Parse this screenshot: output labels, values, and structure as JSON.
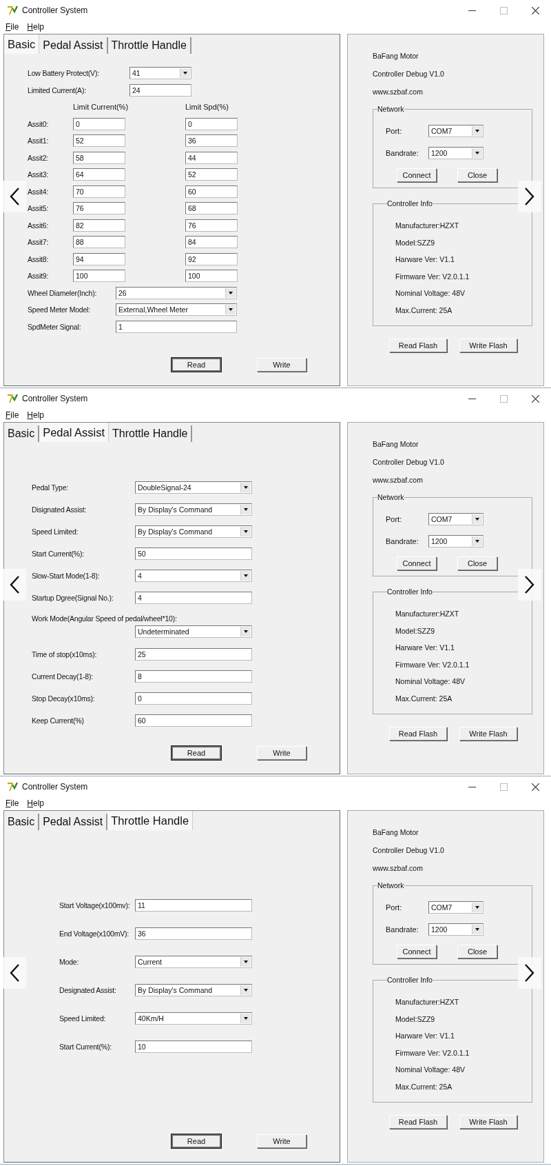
{
  "windows": [
    {
      "title": "Controller System",
      "menu": [
        "File",
        "Help"
      ],
      "tabs": [
        {
          "label": "Basic",
          "selected": true
        },
        {
          "label": "Pedal Assist",
          "selected": false
        },
        {
          "label": "Throttle Handle",
          "selected": false
        }
      ],
      "form": {
        "kind": "basic",
        "top_fields": [
          {
            "kind": "select",
            "label": "Low Battery Protect(V):",
            "value": "41"
          },
          {
            "kind": "input",
            "label": "Limited Current(A):",
            "value": "24"
          }
        ],
        "columns": [
          "Limit Current(%)",
          "Limit Spd(%)"
        ],
        "assists": [
          {
            "label": "Assit0:",
            "current": "0",
            "speed": "0"
          },
          {
            "label": "Assit1:",
            "current": "52",
            "speed": "36"
          },
          {
            "label": "Assit2:",
            "current": "58",
            "speed": "44"
          },
          {
            "label": "Assit3:",
            "current": "64",
            "speed": "52"
          },
          {
            "label": "Assit4:",
            "current": "70",
            "speed": "60"
          },
          {
            "label": "Assit5:",
            "current": "76",
            "speed": "68"
          },
          {
            "label": "Assit6:",
            "current": "82",
            "speed": "76"
          },
          {
            "label": "Assit7:",
            "current": "88",
            "speed": "84"
          },
          {
            "label": "Assit8:",
            "current": "94",
            "speed": "92"
          },
          {
            "label": "Assit9:",
            "current": "100",
            "speed": "100"
          }
        ],
        "bottom_fields": [
          {
            "kind": "select",
            "label": "Wheel Diameler(Inch):",
            "value": "26"
          },
          {
            "kind": "select",
            "label": "Speed Meter Model:",
            "value": "External,Wheel Meter"
          },
          {
            "kind": "input",
            "label": "SpdMeter Signal:",
            "value": "1"
          }
        ]
      },
      "buttons": [
        {
          "label": "Read",
          "default": true
        },
        {
          "label": "Write",
          "default": false
        }
      ],
      "info": {
        "lines": [
          "BaFang Motor",
          "Controller Debug V1.0",
          "www.szbaf.com"
        ],
        "network": {
          "title": "Network",
          "fields": [
            {
              "label": "Port:",
              "value": "COM7"
            },
            {
              "label": "Bandrate:",
              "value": "1200"
            }
          ],
          "buttons": [
            "Connect",
            "Close"
          ]
        },
        "controller": {
          "title": "Controller Info",
          "lines": [
            "Manufacturer:HZXT",
            "Model:SZZ9",
            "Harware Ver: V1.1",
            "Firmware Ver: V2.0.1.1",
            "Nominal Voltage: 48V",
            "Max.Current: 25A"
          ]
        },
        "buttons": [
          "Read Flash",
          "Write Flash"
        ]
      }
    },
    {
      "title": "Controller System",
      "menu": [
        "File",
        "Help"
      ],
      "tabs": [
        {
          "label": "Basic",
          "selected": false
        },
        {
          "label": "Pedal Assist",
          "selected": true
        },
        {
          "label": "Throttle Handle",
          "selected": false
        }
      ],
      "form": {
        "kind": "pedal",
        "fields": [
          {
            "kind": "select",
            "label": "Pedal Type:",
            "value": "DoubleSignal-24"
          },
          {
            "kind": "select",
            "label": "Disignated Assist:",
            "value": "By Display's Command"
          },
          {
            "kind": "select",
            "label": "Speed Limited:",
            "value": "By Display's Command"
          },
          {
            "kind": "input",
            "label": "Start Current(%):",
            "value": "50"
          },
          {
            "kind": "select",
            "label": "Slow-Start Mode(1-8):",
            "value": "4"
          },
          {
            "kind": "input",
            "label": "Startup Dgree(Signal No.):",
            "value": "4"
          },
          {
            "kind": "stacked-select",
            "label": "Work Mode(Angular Speed of pedal/wheel*10):",
            "value": "Undeterminated"
          },
          {
            "kind": "input",
            "label": "Time of stop(x10ms):",
            "value": "25"
          },
          {
            "kind": "input",
            "label": "Current Decay(1-8):",
            "value": "8"
          },
          {
            "kind": "input",
            "label": "Stop Decay(x10ms):",
            "value": "0"
          },
          {
            "kind": "input",
            "label": "Keep Current(%)",
            "value": "60"
          }
        ]
      },
      "buttons": [
        {
          "label": "Read",
          "default": true
        },
        {
          "label": "Write",
          "default": false
        }
      ],
      "info": {
        "lines": [
          "BaFang Motor",
          "Controller Debug V1.0",
          "www.szbaf.com"
        ],
        "network": {
          "title": "Network",
          "fields": [
            {
              "label": "Port:",
              "value": "COM7"
            },
            {
              "label": "Bandrate:",
              "value": "1200"
            }
          ],
          "buttons": [
            "Connect",
            "Close"
          ]
        },
        "controller": {
          "title": "Controller Info",
          "lines": [
            "Manufacturer:HZXT",
            "Model:SZZ9",
            "Harware Ver: V1.1",
            "Firmware Ver: V2.0.1.1",
            "Nominal Voltage: 48V",
            "Max.Current: 25A"
          ]
        },
        "buttons": [
          "Read Flash",
          "Write Flash"
        ]
      }
    },
    {
      "title": "Controller System",
      "menu": [
        "File",
        "Help"
      ],
      "tabs": [
        {
          "label": "Basic",
          "selected": false
        },
        {
          "label": "Pedal Assist",
          "selected": false
        },
        {
          "label": "Throttle Handle",
          "selected": true
        }
      ],
      "form": {
        "kind": "throttle",
        "fields": [
          {
            "kind": "input",
            "label": "Start Voltage(x100mv):",
            "value": "11"
          },
          {
            "kind": "input",
            "label": "End Voltage(x100mV):",
            "value": "36"
          },
          {
            "kind": "select",
            "label": "Mode:",
            "value": "Current"
          },
          {
            "kind": "select",
            "label": "Designated Assist:",
            "value": "By Display's Command"
          },
          {
            "kind": "select",
            "label": "Speed Limited:",
            "value": "40Km/H"
          },
          {
            "kind": "input",
            "label": "Start Current(%):",
            "value": "10"
          }
        ]
      },
      "buttons": [
        {
          "label": "Read",
          "default": true
        },
        {
          "label": "Write",
          "default": false
        }
      ],
      "info": {
        "lines": [
          "BaFang Motor",
          "Controller Debug V1.0",
          "www.szbaf.com"
        ],
        "network": {
          "title": "Network",
          "fields": [
            {
              "label": "Port:",
              "value": "COM7"
            },
            {
              "label": "Bandrate:",
              "value": "1200"
            }
          ],
          "buttons": [
            "Connect",
            "Close"
          ]
        },
        "controller": {
          "title": "Controller Info",
          "lines": [
            "Manufacturer:HZXT",
            "Model:SZZ9",
            "Harware Ver: V1.1",
            "Firmware Ver: V2.0.1.1",
            "Nominal Voltage: 48V",
            "Max.Current: 25A"
          ]
        },
        "buttons": [
          "Read Flash",
          "Write Flash"
        ]
      }
    }
  ]
}
